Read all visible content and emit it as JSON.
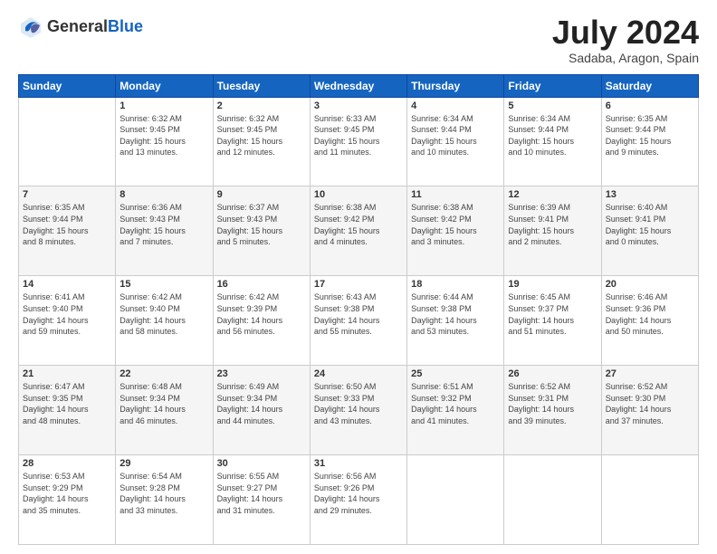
{
  "header": {
    "logo_general": "General",
    "logo_blue": "Blue",
    "month_title": "July 2024",
    "subtitle": "Sadaba, Aragon, Spain"
  },
  "days_of_week": [
    "Sunday",
    "Monday",
    "Tuesday",
    "Wednesday",
    "Thursday",
    "Friday",
    "Saturday"
  ],
  "weeks": [
    [
      {
        "day": "",
        "info": ""
      },
      {
        "day": "1",
        "info": "Sunrise: 6:32 AM\nSunset: 9:45 PM\nDaylight: 15 hours\nand 13 minutes."
      },
      {
        "day": "2",
        "info": "Sunrise: 6:32 AM\nSunset: 9:45 PM\nDaylight: 15 hours\nand 12 minutes."
      },
      {
        "day": "3",
        "info": "Sunrise: 6:33 AM\nSunset: 9:45 PM\nDaylight: 15 hours\nand 11 minutes."
      },
      {
        "day": "4",
        "info": "Sunrise: 6:34 AM\nSunset: 9:44 PM\nDaylight: 15 hours\nand 10 minutes."
      },
      {
        "day": "5",
        "info": "Sunrise: 6:34 AM\nSunset: 9:44 PM\nDaylight: 15 hours\nand 10 minutes."
      },
      {
        "day": "6",
        "info": "Sunrise: 6:35 AM\nSunset: 9:44 PM\nDaylight: 15 hours\nand 9 minutes."
      }
    ],
    [
      {
        "day": "7",
        "info": "Sunrise: 6:35 AM\nSunset: 9:44 PM\nDaylight: 15 hours\nand 8 minutes."
      },
      {
        "day": "8",
        "info": "Sunrise: 6:36 AM\nSunset: 9:43 PM\nDaylight: 15 hours\nand 7 minutes."
      },
      {
        "day": "9",
        "info": "Sunrise: 6:37 AM\nSunset: 9:43 PM\nDaylight: 15 hours\nand 5 minutes."
      },
      {
        "day": "10",
        "info": "Sunrise: 6:38 AM\nSunset: 9:42 PM\nDaylight: 15 hours\nand 4 minutes."
      },
      {
        "day": "11",
        "info": "Sunrise: 6:38 AM\nSunset: 9:42 PM\nDaylight: 15 hours\nand 3 minutes."
      },
      {
        "day": "12",
        "info": "Sunrise: 6:39 AM\nSunset: 9:41 PM\nDaylight: 15 hours\nand 2 minutes."
      },
      {
        "day": "13",
        "info": "Sunrise: 6:40 AM\nSunset: 9:41 PM\nDaylight: 15 hours\nand 0 minutes."
      }
    ],
    [
      {
        "day": "14",
        "info": "Sunrise: 6:41 AM\nSunset: 9:40 PM\nDaylight: 14 hours\nand 59 minutes."
      },
      {
        "day": "15",
        "info": "Sunrise: 6:42 AM\nSunset: 9:40 PM\nDaylight: 14 hours\nand 58 minutes."
      },
      {
        "day": "16",
        "info": "Sunrise: 6:42 AM\nSunset: 9:39 PM\nDaylight: 14 hours\nand 56 minutes."
      },
      {
        "day": "17",
        "info": "Sunrise: 6:43 AM\nSunset: 9:38 PM\nDaylight: 14 hours\nand 55 minutes."
      },
      {
        "day": "18",
        "info": "Sunrise: 6:44 AM\nSunset: 9:38 PM\nDaylight: 14 hours\nand 53 minutes."
      },
      {
        "day": "19",
        "info": "Sunrise: 6:45 AM\nSunset: 9:37 PM\nDaylight: 14 hours\nand 51 minutes."
      },
      {
        "day": "20",
        "info": "Sunrise: 6:46 AM\nSunset: 9:36 PM\nDaylight: 14 hours\nand 50 minutes."
      }
    ],
    [
      {
        "day": "21",
        "info": "Sunrise: 6:47 AM\nSunset: 9:35 PM\nDaylight: 14 hours\nand 48 minutes."
      },
      {
        "day": "22",
        "info": "Sunrise: 6:48 AM\nSunset: 9:34 PM\nDaylight: 14 hours\nand 46 minutes."
      },
      {
        "day": "23",
        "info": "Sunrise: 6:49 AM\nSunset: 9:34 PM\nDaylight: 14 hours\nand 44 minutes."
      },
      {
        "day": "24",
        "info": "Sunrise: 6:50 AM\nSunset: 9:33 PM\nDaylight: 14 hours\nand 43 minutes."
      },
      {
        "day": "25",
        "info": "Sunrise: 6:51 AM\nSunset: 9:32 PM\nDaylight: 14 hours\nand 41 minutes."
      },
      {
        "day": "26",
        "info": "Sunrise: 6:52 AM\nSunset: 9:31 PM\nDaylight: 14 hours\nand 39 minutes."
      },
      {
        "day": "27",
        "info": "Sunrise: 6:52 AM\nSunset: 9:30 PM\nDaylight: 14 hours\nand 37 minutes."
      }
    ],
    [
      {
        "day": "28",
        "info": "Sunrise: 6:53 AM\nSunset: 9:29 PM\nDaylight: 14 hours\nand 35 minutes."
      },
      {
        "day": "29",
        "info": "Sunrise: 6:54 AM\nSunset: 9:28 PM\nDaylight: 14 hours\nand 33 minutes."
      },
      {
        "day": "30",
        "info": "Sunrise: 6:55 AM\nSunset: 9:27 PM\nDaylight: 14 hours\nand 31 minutes."
      },
      {
        "day": "31",
        "info": "Sunrise: 6:56 AM\nSunset: 9:26 PM\nDaylight: 14 hours\nand 29 minutes."
      },
      {
        "day": "",
        "info": ""
      },
      {
        "day": "",
        "info": ""
      },
      {
        "day": "",
        "info": ""
      }
    ]
  ]
}
